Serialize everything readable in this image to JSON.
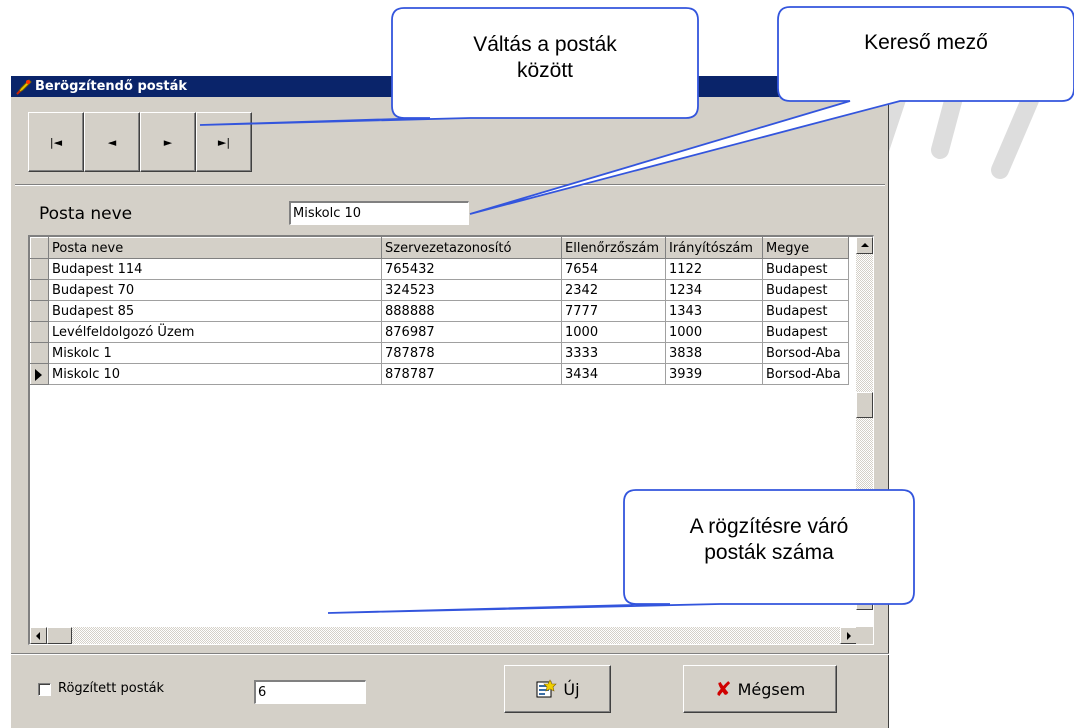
{
  "window": {
    "title": "Berögzítendő posták"
  },
  "nav": {
    "buttons": [
      {
        "name": "first-record-button",
        "glyph": "|◄"
      },
      {
        "name": "prev-record-button",
        "glyph": "◄"
      },
      {
        "name": "next-record-button",
        "glyph": "►"
      },
      {
        "name": "last-record-button",
        "glyph": "►|"
      }
    ]
  },
  "search": {
    "label": "Posta neve",
    "value": "Miskolc 10"
  },
  "grid": {
    "columns": [
      "Posta neve",
      "Szervezetazonosító",
      "Ellenőrzőszám",
      "Irányítószám",
      "Megye"
    ],
    "rows": [
      [
        "Budapest 114",
        "765432",
        "7654",
        "1122",
        "Budapest"
      ],
      [
        "Budapest 70",
        "324523",
        "2342",
        "1234",
        "Budapest"
      ],
      [
        "Budapest 85",
        "888888",
        "7777",
        "1343",
        "Budapest"
      ],
      [
        "Levélfeldolgozó Üzem",
        "876987",
        "1000",
        "1000",
        "Budapest"
      ],
      [
        "Miskolc 1",
        "787878",
        "3333",
        "3838",
        "Borsod-Aba"
      ],
      [
        "Miskolc 10",
        "878787",
        "3434",
        "3939",
        "Borsod-Aba"
      ]
    ],
    "current_row": 5
  },
  "footer": {
    "checkbox_label": "Rögzített posták",
    "checkbox_checked": false,
    "count_value": "6",
    "new_label": "Új",
    "cancel_label": "Mégsem"
  },
  "callouts": {
    "nav": "Váltás a posták\nközött",
    "search": "Kereső mező",
    "count": "A rögzítésre váró\nposták száma"
  },
  "colors": {
    "titlebar": "#0a246a",
    "callout_border": "#3355dd",
    "cancel_icon": "#d00000"
  }
}
